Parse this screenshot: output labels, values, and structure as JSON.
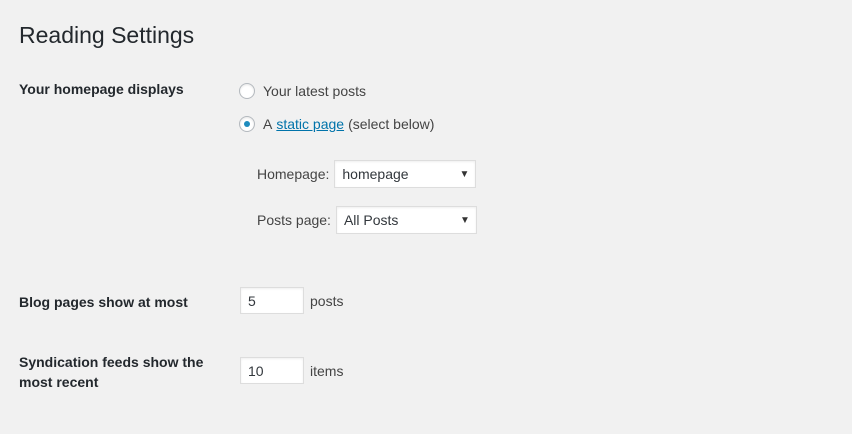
{
  "page": {
    "title": "Reading Settings"
  },
  "homepage_displays": {
    "label": "Your homepage displays",
    "option_latest": "Your latest posts",
    "option_static_prefix": "A",
    "option_static_link": "static page",
    "option_static_suffix": "(select below)",
    "selected": "static",
    "homepage_label": "Homepage:",
    "homepage_value": "homepage",
    "posts_page_label": "Posts page:",
    "posts_page_value": "All Posts"
  },
  "blog_pages": {
    "label": "Blog pages show at most",
    "value": "5",
    "unit": "posts"
  },
  "syndication": {
    "label_line1": "Syndication feeds show the",
    "label_line2": "most recent",
    "value": "10",
    "unit": "items"
  },
  "colors": {
    "background": "#f1f1f1",
    "link": "#0073aa",
    "radio_checked": "#1e8cbe"
  },
  "icons": {
    "dropdown_caret": "▼"
  }
}
